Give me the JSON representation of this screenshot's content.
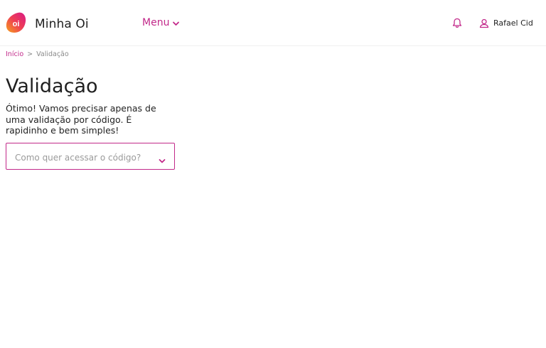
{
  "header": {
    "logo_text": "oi",
    "brand": "Minha Oi",
    "menu_label": "Menu",
    "notifications_icon": "bell-icon",
    "user_icon": "user-icon",
    "user_name": "Rafael Cid"
  },
  "breadcrumb": {
    "home": "Início",
    "separator": ">",
    "current": "Validação"
  },
  "main": {
    "title": "Validação",
    "description": "Ótimo! Vamos precisar apenas de uma validação por código. É rapidinho e bem simples!",
    "select": {
      "placeholder": "Como quer acessar o código?",
      "icon": "chevron-down-icon"
    }
  },
  "colors": {
    "accent": "#c2298a",
    "logo_gradient_start": "#f5a623",
    "logo_gradient_end": "#e0197d",
    "text": "#1f1f1f",
    "muted": "#8a8a8a"
  }
}
